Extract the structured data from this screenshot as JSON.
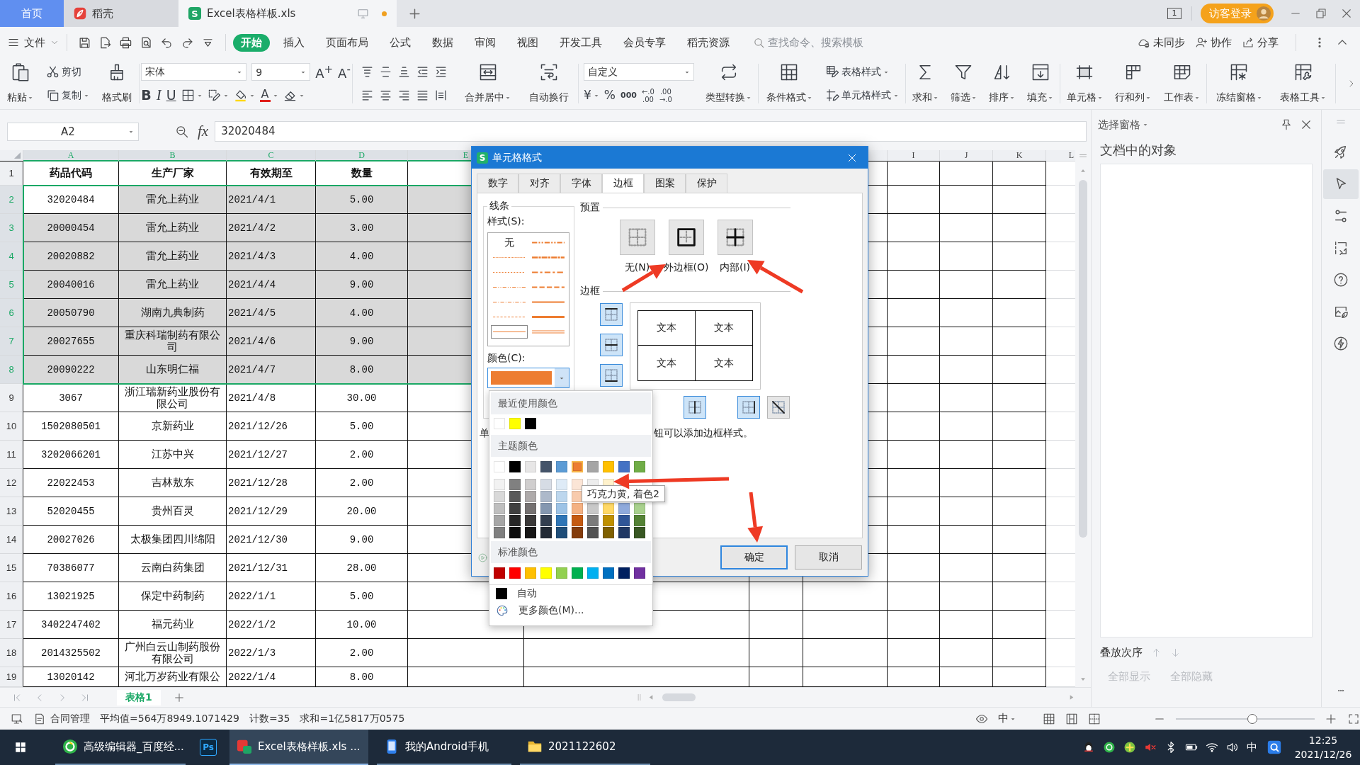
{
  "title_bar": {
    "tabs": [
      {
        "label": "首页",
        "kind": "home",
        "selected": false
      },
      {
        "label": "稻壳",
        "kind": "docer",
        "selected": false
      },
      {
        "label": "Excel表格样板.xls",
        "kind": "sheet",
        "selected": true,
        "logo": "S",
        "unsaved": true
      }
    ],
    "window_number": "1",
    "login": "访客登录"
  },
  "menu_bar": {
    "file": "文件",
    "tabs": [
      {
        "label": "开始",
        "selected": true
      },
      {
        "label": "插入",
        "selected": false
      },
      {
        "label": "页面布局",
        "selected": false
      },
      {
        "label": "公式",
        "selected": false
      },
      {
        "label": "数据",
        "selected": false
      },
      {
        "label": "审阅",
        "selected": false
      },
      {
        "label": "视图",
        "selected": false
      },
      {
        "label": "开发工具",
        "selected": false
      },
      {
        "label": "会员专享",
        "selected": false
      },
      {
        "label": "稻壳资源",
        "selected": false
      }
    ],
    "search": {
      "placeholder": "查找命令、搜索模板"
    },
    "actions": [
      {
        "kind": "sync",
        "label": "未同步"
      },
      {
        "kind": "collab",
        "label": "协作"
      },
      {
        "kind": "share",
        "label": "分享"
      }
    ]
  },
  "ribbon": [
    {
      "cols": [
        {
          "kind": "paste",
          "label": "粘贴",
          "dropdown": true
        },
        {
          "stack": [
            [
              {
                "kind": "cut",
                "label": "剪切",
                "dropdown": false
              }
            ],
            [
              {
                "kind": "copy",
                "label": "复制",
                "dropdown": true
              }
            ]
          ]
        },
        {
          "kind": "format_painter",
          "label": "格式刷",
          "dropdown": false
        }
      ]
    },
    {
      "cols": [
        {
          "stack": [
            [
              {
                "kind": "font_name",
                "value": "宋体"
              },
              {
                "kind": "font_size",
                "value": "9"
              },
              {
                "kind": "grow",
                "text": "A$^{+}$",
                "dropdown": false
              },
              {
                "kind": "shrink",
                "text": "A$^{-}$",
                "dropdown": false
              }
            ],
            [
              {
                "kind": "bold",
                "text": "B",
                "dropdown": false
              },
              {
                "kind": "italic",
                "text": "I",
                "dropdown": false
              },
              {
                "kind": "underline",
                "text": "U",
                "dropdown": false
              },
              {
                "kind": "borders",
                "dropdown": true
              },
              {
                "kind": "pattern",
                "dropdown": true
              },
              {
                "kind": "fill_color",
                "dropdown": true
              },
              {
                "kind": "font_color",
                "text": "A",
                "dropdown": true
              },
              {
                "kind": "eraser",
                "dropdown": true
              }
            ]
          ]
        }
      ]
    },
    {
      "cols": [
        {
          "stack": [
            [
              {
                "kind": "align_top",
                "dropdown": false
              },
              {
                "kind": "align_middle",
                "dropdown": false
              },
              {
                "kind": "align_bottom",
                "dropdown": false
              },
              {
                "kind": "indent_less",
                "dropdown": false
              },
              {
                "kind": "indent_more",
                "dropdown": false
              }
            ],
            [
              {
                "kind": "align_left",
                "dropdown": false
              },
              {
                "kind": "align_center",
                "dropdown": false
              },
              {
                "kind": "align_right",
                "dropdown": false
              },
              {
                "kind": "justify",
                "dropdown": false
              },
              {
                "kind": "distribute",
                "dropdown": false
              }
            ]
          ]
        },
        {
          "kind": "merge",
          "label": "合并居中",
          "dropdown": true
        },
        {
          "kind": "wrap",
          "label": "自动换行",
          "dropdown": false
        }
      ]
    },
    {
      "cols": [
        {
          "stack": [
            [
              {
                "kind": "number_format",
                "value": "自定义"
              }
            ],
            [
              {
                "kind": "currency",
                "text": "¥",
                "dropdown": true
              },
              {
                "kind": "percent",
                "text": "%",
                "dropdown": false
              },
              {
                "kind": "thousands",
                "text": "000",
                "dropdown": false
              },
              {
                "kind": "dec_more",
                "text": "←.0",
                "sub": ".00",
                "dropdown": false
              },
              {
                "kind": "dec_less",
                "text": ".00",
                "sub": "→.0",
                "dropdown": false
              }
            ]
          ]
        },
        {
          "kind": "convert",
          "label": "类型转换",
          "dropdown": true
        }
      ]
    },
    {
      "cols": [
        {
          "kind": "cond_format",
          "label": "条件格式",
          "dropdown": true
        },
        {
          "stack": [
            [
              {
                "kind": "table_style",
                "label": "表格样式",
                "dropdown": true
              }
            ],
            [
              {
                "kind": "cell_style",
                "label": "单元格样式",
                "dropdown": true
              }
            ]
          ]
        }
      ]
    },
    {
      "cols": [
        {
          "kind": "sum",
          "label": "求和",
          "dropdown": true
        },
        {
          "kind": "filter",
          "label": "筛选",
          "dropdown": true
        },
        {
          "kind": "sort",
          "label": "排序",
          "dropdown": true
        },
        {
          "kind": "fill_down",
          "label": "填充",
          "dropdown": true
        }
      ]
    },
    {
      "cols": [
        {
          "kind": "cell",
          "label": "单元格",
          "dropdown": true
        },
        {
          "kind": "rowcol",
          "label": "行和列",
          "dropdown": true
        },
        {
          "kind": "sheet",
          "label": "工作表",
          "dropdown": true
        }
      ]
    },
    {
      "cols": [
        {
          "kind": "freeze",
          "label": "冻结窗格",
          "dropdown": true
        },
        {
          "kind": "tools",
          "label": "表格工具",
          "dropdown": true
        }
      ]
    }
  ],
  "formula_bar": {
    "name_box": "A2",
    "fx": "fx",
    "value": "32020484"
  },
  "sheet": {
    "columns": [
      {
        "label": "A",
        "selected": true
      },
      {
        "label": "B",
        "selected": true
      },
      {
        "label": "C",
        "selected": true
      },
      {
        "label": "D",
        "selected": true
      },
      {
        "label": "E",
        "selected": true
      },
      {
        "label": "I",
        "selected": false
      },
      {
        "label": "J",
        "selected": false
      },
      {
        "label": "K",
        "selected": false
      },
      {
        "label": "L",
        "selected": false
      }
    ],
    "rows": [
      {
        "number": "1",
        "kind": "header",
        "selected": false,
        "cells": [
          "药品代码",
          "生产厂家",
          "有效期至",
          "数量"
        ]
      },
      {
        "number": "2",
        "kind": "data",
        "selected": true,
        "active": true,
        "cells": [
          "32020484",
          "雷允上药业",
          "2021/4/1",
          "5.00"
        ]
      },
      {
        "number": "3",
        "kind": "data",
        "selected": true,
        "cells": [
          "20000454",
          "雷允上药业",
          "2021/4/2",
          "3.00"
        ]
      },
      {
        "number": "4",
        "kind": "data",
        "selected": true,
        "cells": [
          "20020882",
          "雷允上药业",
          "2021/4/3",
          "4.00"
        ]
      },
      {
        "number": "5",
        "kind": "data",
        "selected": true,
        "cells": [
          "20040016",
          "雷允上药业",
          "2021/4/4",
          "9.00"
        ]
      },
      {
        "number": "6",
        "kind": "data",
        "selected": true,
        "cells": [
          "20050790",
          "湖南九典制药",
          "2021/4/5",
          "4.00"
        ]
      },
      {
        "number": "7",
        "kind": "data",
        "selected": true,
        "cells": [
          "20027655",
          "重庆科瑞制药有限公司",
          "2021/4/6",
          "9.00"
        ]
      },
      {
        "number": "8",
        "kind": "data",
        "selected": true,
        "cells": [
          "20090222",
          "山东明仁福",
          "2021/4/7",
          "8.00"
        ]
      },
      {
        "number": "9",
        "kind": "data",
        "selected": false,
        "cells": [
          "3067",
          "浙江瑞新药业股份有限公司",
          "2021/4/8",
          "30.00"
        ]
      },
      {
        "number": "10",
        "kind": "data",
        "selected": false,
        "cells": [
          "1502080501",
          "京新药业",
          "2021/12/26",
          "5.00"
        ]
      },
      {
        "number": "11",
        "kind": "data",
        "selected": false,
        "cells": [
          "3202066201",
          "江苏中兴",
          "2021/12/27",
          "2.00"
        ]
      },
      {
        "number": "12",
        "kind": "data",
        "selected": false,
        "cells": [
          "22022453",
          "吉林敖东",
          "2021/12/28",
          "2.00"
        ]
      },
      {
        "number": "13",
        "kind": "data",
        "selected": false,
        "cells": [
          "52020455",
          "贵州百灵",
          "2021/12/29",
          "20.00"
        ]
      },
      {
        "number": "14",
        "kind": "data",
        "selected": false,
        "cells": [
          "20027026",
          "太极集团四川绵阳",
          "2021/12/30",
          "9.00"
        ]
      },
      {
        "number": "15",
        "kind": "data",
        "selected": false,
        "cells": [
          "70386077",
          "云南白药集团",
          "2021/12/31",
          "28.00"
        ]
      },
      {
        "number": "16",
        "kind": "data",
        "selected": false,
        "cells": [
          "13021925",
          "保定中药制药",
          "2022/1/1",
          "5.00"
        ]
      },
      {
        "number": "17",
        "kind": "data",
        "selected": false,
        "cells": [
          "3402247402",
          "福元药业",
          "2022/1/2",
          "10.00"
        ]
      },
      {
        "number": "18",
        "kind": "data",
        "selected": false,
        "cells": [
          "2014325502",
          "广州白云山制药股份有限公司",
          "2022/1/3",
          "2.00"
        ]
      },
      {
        "number": "19",
        "kind": "data",
        "selected": false,
        "cells": [
          "13020142",
          "河北万岁药业有限公",
          "2022/1/4",
          "8.00"
        ]
      }
    ],
    "tabs": [
      {
        "label": "表格1",
        "selected": true
      }
    ]
  },
  "dialog": {
    "logo": "S",
    "title": "单元格格式",
    "tabs": [
      {
        "label": "数字",
        "selected": false
      },
      {
        "label": "对齐",
        "selected": false
      },
      {
        "label": "字体",
        "selected": false
      },
      {
        "label": "边框",
        "selected": true
      },
      {
        "label": "图案",
        "selected": false
      },
      {
        "label": "保护",
        "selected": false
      }
    ],
    "line_group": "线条",
    "style_label": "样式(S):",
    "line_styles": [
      {
        "kind": "none",
        "label": "无",
        "selected": false
      },
      {
        "kind": "medium_dash_dot_dot",
        "selected": false
      },
      {
        "kind": "hair",
        "selected": false
      },
      {
        "kind": "slant_dash_dot",
        "selected": false
      },
      {
        "kind": "dotted",
        "selected": false
      },
      {
        "kind": "medium_dash_dot",
        "selected": false
      },
      {
        "kind": "dash_dot_dot",
        "selected": false
      },
      {
        "kind": "medium_dashed",
        "selected": false
      },
      {
        "kind": "dash_dot",
        "selected": false
      },
      {
        "kind": "medium",
        "selected": false
      },
      {
        "kind": "dashed",
        "selected": false
      },
      {
        "kind": "thick",
        "selected": false
      },
      {
        "kind": "thin",
        "selected": true
      },
      {
        "kind": "double",
        "selected": false
      }
    ],
    "color_label": "颜色(C):",
    "color": "#ed7d31",
    "presets_label": "预置",
    "presets": [
      {
        "kind": "none",
        "label": "无(N)"
      },
      {
        "kind": "outline",
        "label": "外边框(O)"
      },
      {
        "kind": "inside",
        "label": "内部(I)"
      }
    ],
    "border_label": "边框",
    "border_buttons": [
      {
        "kind": "top",
        "on": true
      },
      {
        "kind": "inner_h",
        "on": true
      },
      {
        "kind": "bottom",
        "on": true
      },
      {
        "kind": "inner_v",
        "on": true
      },
      {
        "kind": "right",
        "on": true
      },
      {
        "kind": "diagonal",
        "on": false
      }
    ],
    "preview_texts": [
      "文本",
      "文本",
      "文本",
      "文本"
    ],
    "hint_start": "单",
    "hint_end": "钮可以添加边框样式。",
    "ok": "确定",
    "cancel": "取消"
  },
  "color_menu": {
    "recent_label": "最近使用颜色",
    "recent": [
      {
        "color": "#ffffff"
      },
      {
        "color": "#ffff00"
      },
      {
        "color": "#000000"
      }
    ],
    "theme_label": "主题颜色",
    "theme": [
      {
        "color": "#ffffff",
        "selected": false
      },
      {
        "color": "#000000",
        "selected": false
      },
      {
        "color": "#e7e6e6",
        "selected": false
      },
      {
        "color": "#44546a",
        "selected": false
      },
      {
        "color": "#5b9bd5",
        "selected": false
      },
      {
        "color": "#ed7d31",
        "selected": true
      },
      {
        "color": "#a5a5a5",
        "selected": false
      },
      {
        "color": "#ffc000",
        "selected": false
      },
      {
        "color": "#4472c4",
        "selected": false
      },
      {
        "color": "#70ad47",
        "selected": false
      }
    ],
    "shades": [
      [
        {
          "color": "#f2f2f2"
        },
        {
          "color": "#808080"
        },
        {
          "color": "#d0cece"
        },
        {
          "color": "#d6dce5"
        },
        {
          "color": "#deebf7"
        },
        {
          "color": "#fbe5d6"
        },
        {
          "color": "#ededed"
        },
        {
          "color": "#fff2cc"
        }
      ],
      [
        {
          "color": "#d9d9d9"
        },
        {
          "color": "#595959"
        },
        {
          "color": "#aeaaaa"
        },
        {
          "color": "#adb9ca"
        },
        {
          "color": "#bdd7ee"
        },
        {
          "color": "#f8cbad"
        }
      ],
      [
        {
          "color": "#bfbfbf"
        },
        {
          "color": "#404040"
        },
        {
          "color": "#757171"
        },
        {
          "color": "#8497b0"
        },
        {
          "color": "#9dc3e6"
        },
        {
          "color": "#f4b183"
        },
        {
          "color": "#c9c9c9"
        },
        {
          "color": "#ffd966"
        },
        {
          "color": "#8faadc"
        },
        {
          "color": "#a9d18e"
        }
      ],
      [
        {
          "color": "#a6a6a6"
        },
        {
          "color": "#262626"
        },
        {
          "color": "#3a3838"
        },
        {
          "color": "#333f50"
        },
        {
          "color": "#2e75b6"
        },
        {
          "color": "#c55a11"
        },
        {
          "color": "#7b7b7b"
        },
        {
          "color": "#bf9000"
        },
        {
          "color": "#2f5597"
        },
        {
          "color": "#548235"
        }
      ],
      [
        {
          "color": "#808080"
        },
        {
          "color": "#0d0d0d"
        },
        {
          "color": "#171616"
        },
        {
          "color": "#222a35"
        },
        {
          "color": "#1f4e79"
        },
        {
          "color": "#843c0c"
        },
        {
          "color": "#525252"
        },
        {
          "color": "#7f6000"
        },
        {
          "color": "#203864"
        },
        {
          "color": "#385723"
        }
      ]
    ],
    "standard_label": "标准颜色",
    "standard": [
      {
        "color": "#c00000"
      },
      {
        "color": "#ff0000"
      },
      {
        "color": "#ffc000"
      },
      {
        "color": "#ffff00"
      },
      {
        "color": "#92d050"
      },
      {
        "color": "#00b050"
      },
      {
        "color": "#00b0f0"
      },
      {
        "color": "#0070c0"
      },
      {
        "color": "#002060"
      },
      {
        "color": "#7030a0"
      }
    ],
    "auto": "自动",
    "more": "更多颜色(M)...",
    "tooltip": "巧克力黄, 着色2"
  },
  "selection_pane": {
    "title": "选择窗格",
    "heading": "文档中的对象",
    "order_label": "叠放次序",
    "show_all": "全部显示",
    "hide_all": "全部隐藏"
  },
  "side_tools": [
    {
      "kind": "rocket",
      "selected": false
    },
    {
      "kind": "cursor",
      "selected": true
    },
    {
      "kind": "sliders",
      "selected": false
    },
    {
      "kind": "transfer",
      "selected": false
    },
    {
      "kind": "help",
      "selected": false
    },
    {
      "kind": "picture",
      "selected": false
    },
    {
      "kind": "bolt",
      "selected": false
    }
  ],
  "status_bar": {
    "contract": "合同管理",
    "stats": [
      "平均值=564万8949.1071429",
      "计数=35",
      "求和=1亿5817万0575"
    ],
    "ime": "中",
    "zoom": {
      "level": 0.55
    }
  },
  "taskbar": {
    "apps": [
      {
        "kind": "browser",
        "label": "高级编辑器_百度经...",
        "selected": false
      },
      {
        "kind": "tile",
        "label": "Ps",
        "selected": false
      },
      {
        "kind": "wps",
        "label": "Excel表格样板.xls ...",
        "selected": true
      },
      {
        "kind": "phone",
        "label": "我的Android手机",
        "selected": false
      },
      {
        "kind": "folder",
        "label": "2021122602",
        "selected": false
      }
    ],
    "ime": "中",
    "time": "12:25",
    "date": "2021/12/26"
  }
}
